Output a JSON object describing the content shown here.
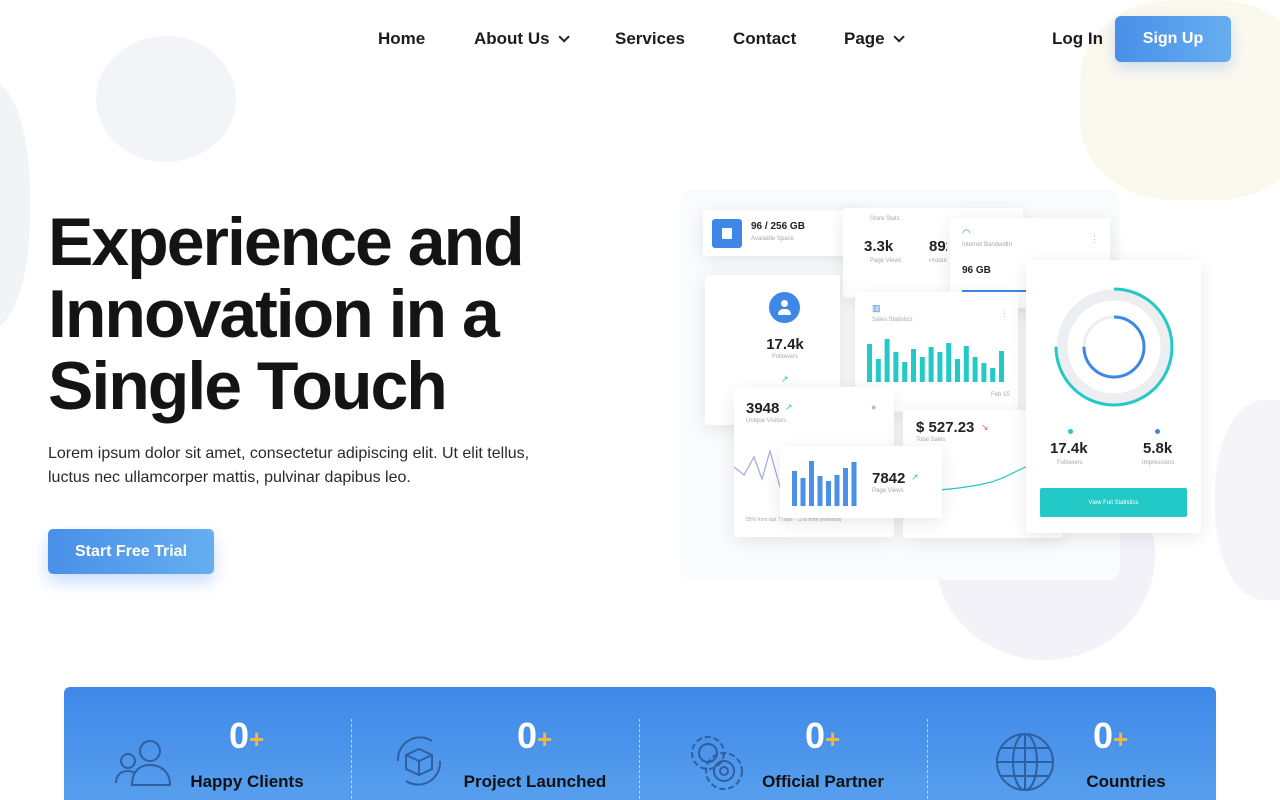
{
  "nav": {
    "items": [
      {
        "label": "Home",
        "has_dropdown": false
      },
      {
        "label": "About Us",
        "has_dropdown": true
      },
      {
        "label": "Services",
        "has_dropdown": false
      },
      {
        "label": "Contact",
        "has_dropdown": false
      },
      {
        "label": "Page",
        "has_dropdown": true
      }
    ],
    "login": "Log In",
    "signup": "Sign Up"
  },
  "hero": {
    "title_lines": [
      "Experience and",
      "Innovation in a",
      "Single Touch"
    ],
    "description_lines": [
      "Lorem ipsum dolor sit amet, consectetur adipiscing elit. Ut elit tellus,",
      "luctus nec ullamcorper mattis, pulvinar dapibus leo."
    ],
    "cta": "Start Free Trial"
  },
  "dashboard": {
    "storage": {
      "value": "96 / 256 GB",
      "label": "Available Space"
    },
    "store": {
      "title": "Store Stats",
      "page_views": "3.3k",
      "page_views_label": "Page Views",
      "products": "892",
      "products_label": "Products"
    },
    "bandwidth": {
      "label": "Internet Bandwidth",
      "value": "96 GB"
    },
    "followers_card": {
      "value": "17.4k",
      "label": "Followers"
    },
    "sales_stats": {
      "title": "Sales Statistics",
      "date": "Feb 15",
      "bars": [
        0.75,
        0.45,
        0.85,
        0.6,
        0.4,
        0.65,
        0.5,
        0.7,
        0.6,
        0.78,
        0.45,
        0.72,
        0.5,
        0.38,
        0.28,
        0.62
      ]
    },
    "visitors": {
      "value": "3948",
      "label": "Unique Visitors",
      "footer": "55% from last 7 days · 12% from yesterday"
    },
    "page_views_card": {
      "value": "7842",
      "label": "Page Views",
      "bars": [
        0.7,
        0.55,
        0.9,
        0.6,
        0.5,
        0.62,
        0.75,
        0.88
      ]
    },
    "total_sales": {
      "value": "$ 527.23",
      "label": "Total Sales"
    },
    "donut": {
      "fraction": 0.75,
      "followers": "17.4k",
      "followers_label": "Followers",
      "impressions": "5.8k",
      "impressions_label": "Impressions",
      "button": "View Full Statistics"
    }
  },
  "stats": [
    {
      "number": "0",
      "plus": "+",
      "label": "Happy Clients",
      "icon": "users-icon"
    },
    {
      "number": "0",
      "plus": "+",
      "label": "Project Launched",
      "icon": "box-icon"
    },
    {
      "number": "0",
      "plus": "+",
      "label": "Official Partner",
      "icon": "gear-icon"
    },
    {
      "number": "0",
      "plus": "+",
      "label": "Countries",
      "icon": "globe-icon"
    }
  ],
  "colors": {
    "accent": "#4a8fe8",
    "teal": "#22c9c6",
    "orange": "#f6b63b",
    "text": "#141414"
  }
}
